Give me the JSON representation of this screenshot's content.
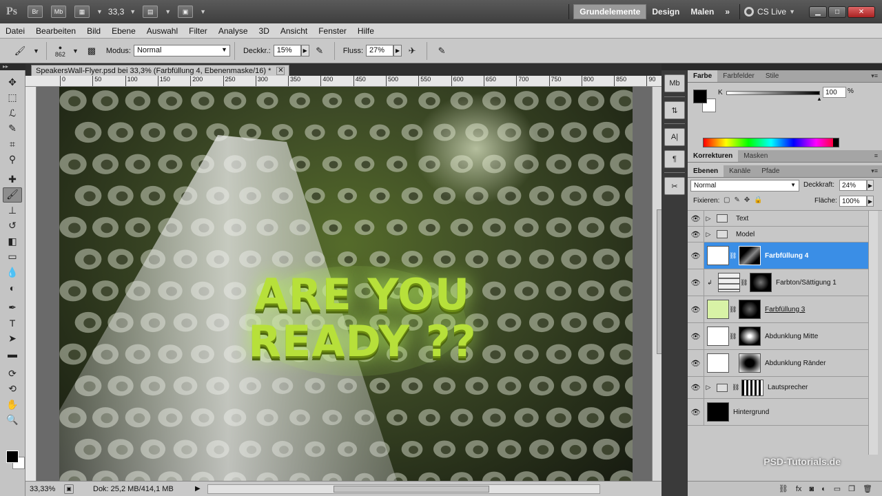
{
  "titlebar": {
    "logo": "Ps",
    "icons": [
      "Br",
      "Mb"
    ],
    "zoom": "33,3",
    "workspaces": [
      "Grundelemente",
      "Design",
      "Malen"
    ],
    "more": "»",
    "cslive": "CS Live"
  },
  "menu": [
    "Datei",
    "Bearbeiten",
    "Bild",
    "Ebene",
    "Auswahl",
    "Filter",
    "Analyse",
    "3D",
    "Ansicht",
    "Fenster",
    "Hilfe"
  ],
  "options": {
    "brush_size": "862",
    "mode_label": "Modus:",
    "mode_value": "Normal",
    "opacity_label": "Deckkr.:",
    "opacity_value": "15%",
    "flow_label": "Fluss:",
    "flow_value": "27%"
  },
  "document": {
    "tab_title": "SpeakersWall-Flyer.psd bei 33,3% (Farbfüllung 4, Ebenenmaske/16) *",
    "ruler_ticks": [
      "0",
      "50",
      "100",
      "150",
      "200",
      "250",
      "300",
      "350",
      "400",
      "450",
      "500",
      "550",
      "600",
      "650",
      "700",
      "750",
      "800",
      "850",
      "90"
    ],
    "headline_line1": "ARE YOU",
    "headline_line2": "READY ??",
    "status_zoom": "33,33%",
    "status_doc": "Dok: 25,2 MB/414,1 MB"
  },
  "color_panel": {
    "tabs": [
      "Farbe",
      "Farbfelder",
      "Stile"
    ],
    "k_label": "K",
    "k_value": "100",
    "k_unit": "%"
  },
  "adjust_tabs": [
    "Korrekturen",
    "Masken"
  ],
  "layers_panel": {
    "tabs": [
      "Ebenen",
      "Kanäle",
      "Pfade"
    ],
    "blend_mode": "Normal",
    "opacity_label": "Deckkraft:",
    "opacity_value": "24%",
    "lock_label": "Fixieren:",
    "fill_label": "Fläche:",
    "fill_value": "100%",
    "layers": [
      {
        "name": "Text"
      },
      {
        "name": "Model"
      },
      {
        "name": "Farbfüllung 4"
      },
      {
        "name": "Farbton/Sättigung 1"
      },
      {
        "name": "Farbfüllung 3"
      },
      {
        "name": "Abdunklung Mitte"
      },
      {
        "name": "Abdunklung Ränder"
      },
      {
        "name": "Lautsprecher"
      },
      {
        "name": "Hintergrund"
      }
    ]
  },
  "watermark": "PSD-Tutorials.de"
}
